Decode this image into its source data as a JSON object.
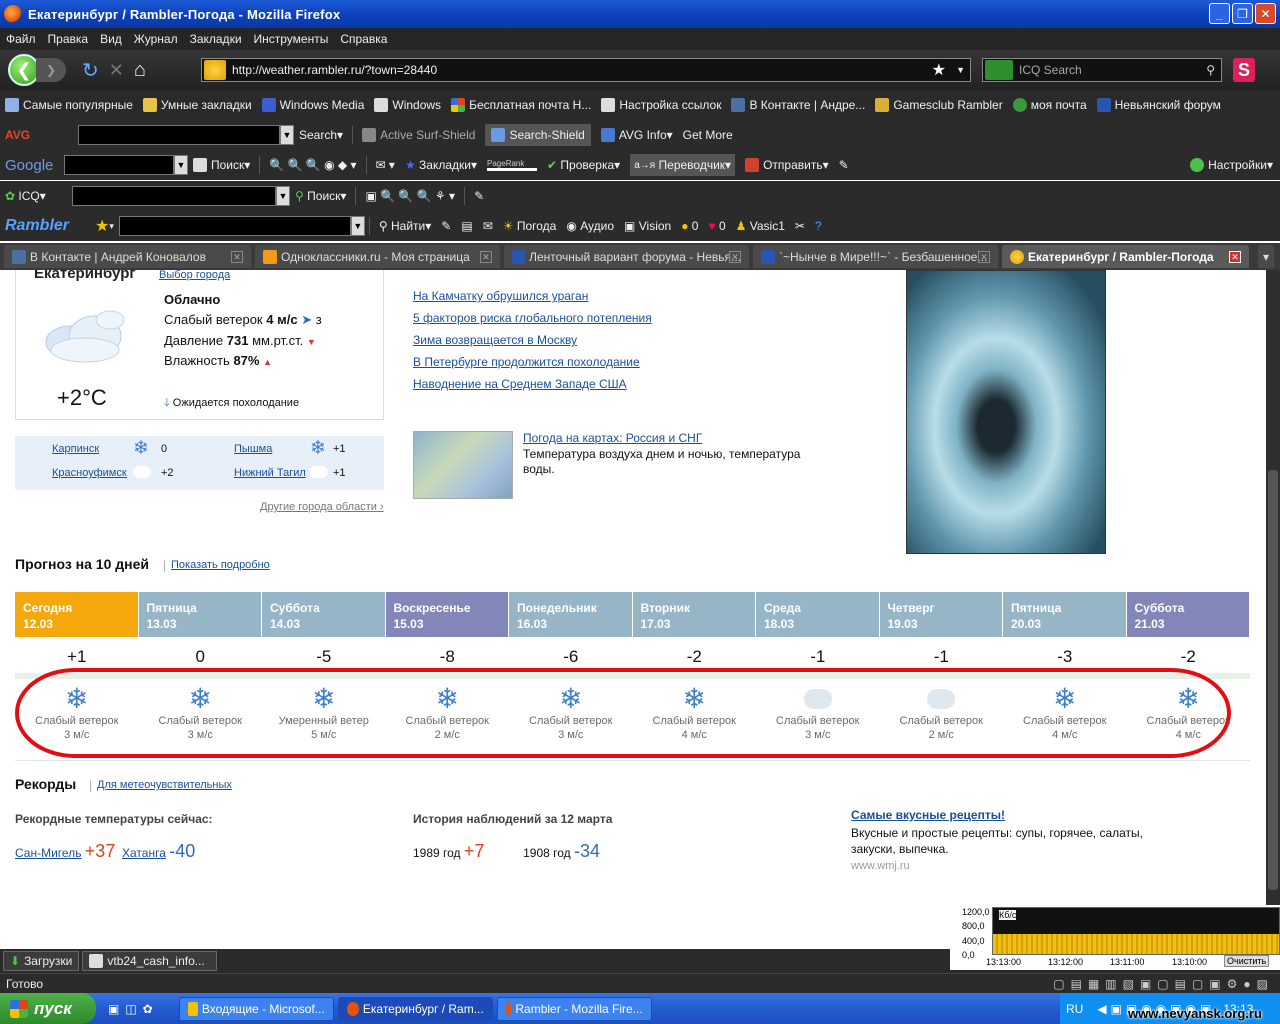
{
  "window": {
    "title": "Екатеринбург / Rambler-Погода - Mozilla Firefox"
  },
  "menu": [
    "Файл",
    "Правка",
    "Вид",
    "Журнал",
    "Закладки",
    "Инструменты",
    "Справка"
  ],
  "nav": {
    "url": "http://weather.rambler.ru/?town=28440",
    "search_placeholder": "ICQ Search"
  },
  "bookmarks": [
    "Самые популярные",
    "Умные закладки",
    "Windows Media",
    "Windows",
    "Бесплатная почта Н...",
    "Настройка ссылок",
    "В Контакте | Андре...",
    "Gamesclub Rambler",
    "моя почта",
    "Невьянский форум"
  ],
  "toolbars": {
    "avg": {
      "logo": "AVG",
      "search": "Search",
      "surf": "Active Surf-Shield",
      "shield": "Search-Shield",
      "info": "AVG Info",
      "more": "Get More"
    },
    "google": {
      "logo": "Google",
      "search": "Поиск",
      "bookmarks": "Закладки",
      "pagerank": "PageRank",
      "check": "Проверка",
      "translator": "Переводчик",
      "send": "Отправить",
      "settings": "Настройки"
    },
    "icq": {
      "logo": "ICQ",
      "search": "Поиск"
    },
    "rambler": {
      "logo": "Rambler",
      "find": "Найти",
      "weather": "Погода",
      "audio": "Аудио",
      "vision": "Vision",
      "count1": "0",
      "count2": "0",
      "user": "Vasic1"
    }
  },
  "tabs": [
    {
      "label": "В Контакте | Андрей Коновалов"
    },
    {
      "label": "Одноклассники.ru - Моя страница"
    },
    {
      "label": "Ленточный вариант форума - Невья..."
    },
    {
      "label": "`~Нынче в Мире!!!~` - Безбашенное..."
    },
    {
      "label": "Екатеринбург / Rambler-Погода"
    }
  ],
  "weather": {
    "city": "Екатеринбург",
    "choose_city": "Выбор города",
    "condition": "Облачно",
    "wind_label": "Слабый ветерок",
    "wind_value": "4 м/с",
    "wind_dir": "з",
    "pressure_label": "Давление",
    "pressure_value": "731",
    "pressure_unit": "мм.рт.ст.",
    "humidity_label": "Влажность",
    "humidity_value": "87%",
    "temp": "+2°C",
    "expect": "Ожидается похолодание"
  },
  "region": [
    {
      "name": "Карпинск",
      "temp": "0"
    },
    {
      "name": "Пышма",
      "temp": "+1"
    },
    {
      "name": "Красноуфимск",
      "temp": "+2"
    },
    {
      "name": "Нижний Тагил",
      "temp": "+1"
    }
  ],
  "other_cities": "Другие города области",
  "news": [
    "На Камчатку обрушился ураган",
    "5 факторов риска глобального потепления",
    "Зима возвращается в Москву",
    "В Петербурге продолжится похолодание",
    "Наводнение на Среднем Западе США"
  ],
  "map": {
    "link": "Погода на картах: Россия и СНГ",
    "desc": "Температура воздуха днем и ночью, температура воды."
  },
  "forecast": {
    "title": "Прогноз на 10 дней",
    "more": "Показать подробно",
    "days": [
      {
        "name": "Сегодня",
        "date": "12.03",
        "temp": "+1",
        "icon": "snow",
        "wind": "Слабый ветерок",
        "speed": "3 м/с"
      },
      {
        "name": "Пятница",
        "date": "13.03",
        "temp": "0",
        "icon": "snow",
        "wind": "Слабый ветерок",
        "speed": "3 м/с"
      },
      {
        "name": "Суббота",
        "date": "14.03",
        "temp": "-5",
        "icon": "snow",
        "wind": "Умеренный ветер",
        "speed": "5 м/с"
      },
      {
        "name": "Воскресенье",
        "date": "15.03",
        "temp": "-8",
        "icon": "snow",
        "wind": "Слабый ветерок",
        "speed": "2 м/с"
      },
      {
        "name": "Понедельник",
        "date": "16.03",
        "temp": "-6",
        "icon": "snow",
        "wind": "Слабый ветерок",
        "speed": "3 м/с"
      },
      {
        "name": "Вторник",
        "date": "17.03",
        "temp": "-2",
        "icon": "snow",
        "wind": "Слабый ветерок",
        "speed": "4 м/с"
      },
      {
        "name": "Среда",
        "date": "18.03",
        "temp": "-1",
        "icon": "cloud",
        "wind": "Слабый ветерок",
        "speed": "3 м/с"
      },
      {
        "name": "Четверг",
        "date": "19.03",
        "temp": "-1",
        "icon": "cloud",
        "wind": "Слабый ветерок",
        "speed": "2 м/с"
      },
      {
        "name": "Пятница",
        "date": "20.03",
        "temp": "-3",
        "icon": "snow",
        "wind": "Слабый ветерок",
        "speed": "4 м/с"
      },
      {
        "name": "Суббота",
        "date": "21.03",
        "temp": "-2",
        "icon": "snow",
        "wind": "Слабый ветерок",
        "speed": "4 м/с"
      }
    ]
  },
  "records": {
    "title": "Рекорды",
    "link": "Для метеочувствительных",
    "now_title": "Рекордные температуры сейчас:",
    "hot_city": "Сан-Мигель",
    "hot_val": "+37",
    "cold_city": "Хатанга",
    "cold_val": "-40",
    "history_title": "История наблюдений за 12 марта",
    "year1": "1989 год",
    "val1": "+7",
    "year2": "1908 год",
    "val2": "-34"
  },
  "ad": {
    "title": "Самые вкусные рецепты!",
    "desc": "Вкусные и простые рецепты: супы, горячее, салаты, закуски, выпечка.",
    "url": "www.wmj.ru"
  },
  "graph": {
    "unit": "Кб/с",
    "y_labels": [
      "1200,0",
      "800,0",
      "400,0",
      "0,0"
    ],
    "x_labels": [
      "13:13:00",
      "13:12:00",
      "13:11:00",
      "13:10:00"
    ],
    "clear": "Очистить"
  },
  "downloads": {
    "label": "Загрузки",
    "file": "vtb24_cash_info..."
  },
  "status": "Готово",
  "taskbar": {
    "start": "пуск",
    "tasks": [
      "Входящие - Microsof...",
      "Екатеринбург / Ram...",
      "Rambler - Mozilla Fire..."
    ],
    "lang": "RU",
    "clock": "13:13"
  },
  "watermark": "www.nevyansk.org.ru"
}
